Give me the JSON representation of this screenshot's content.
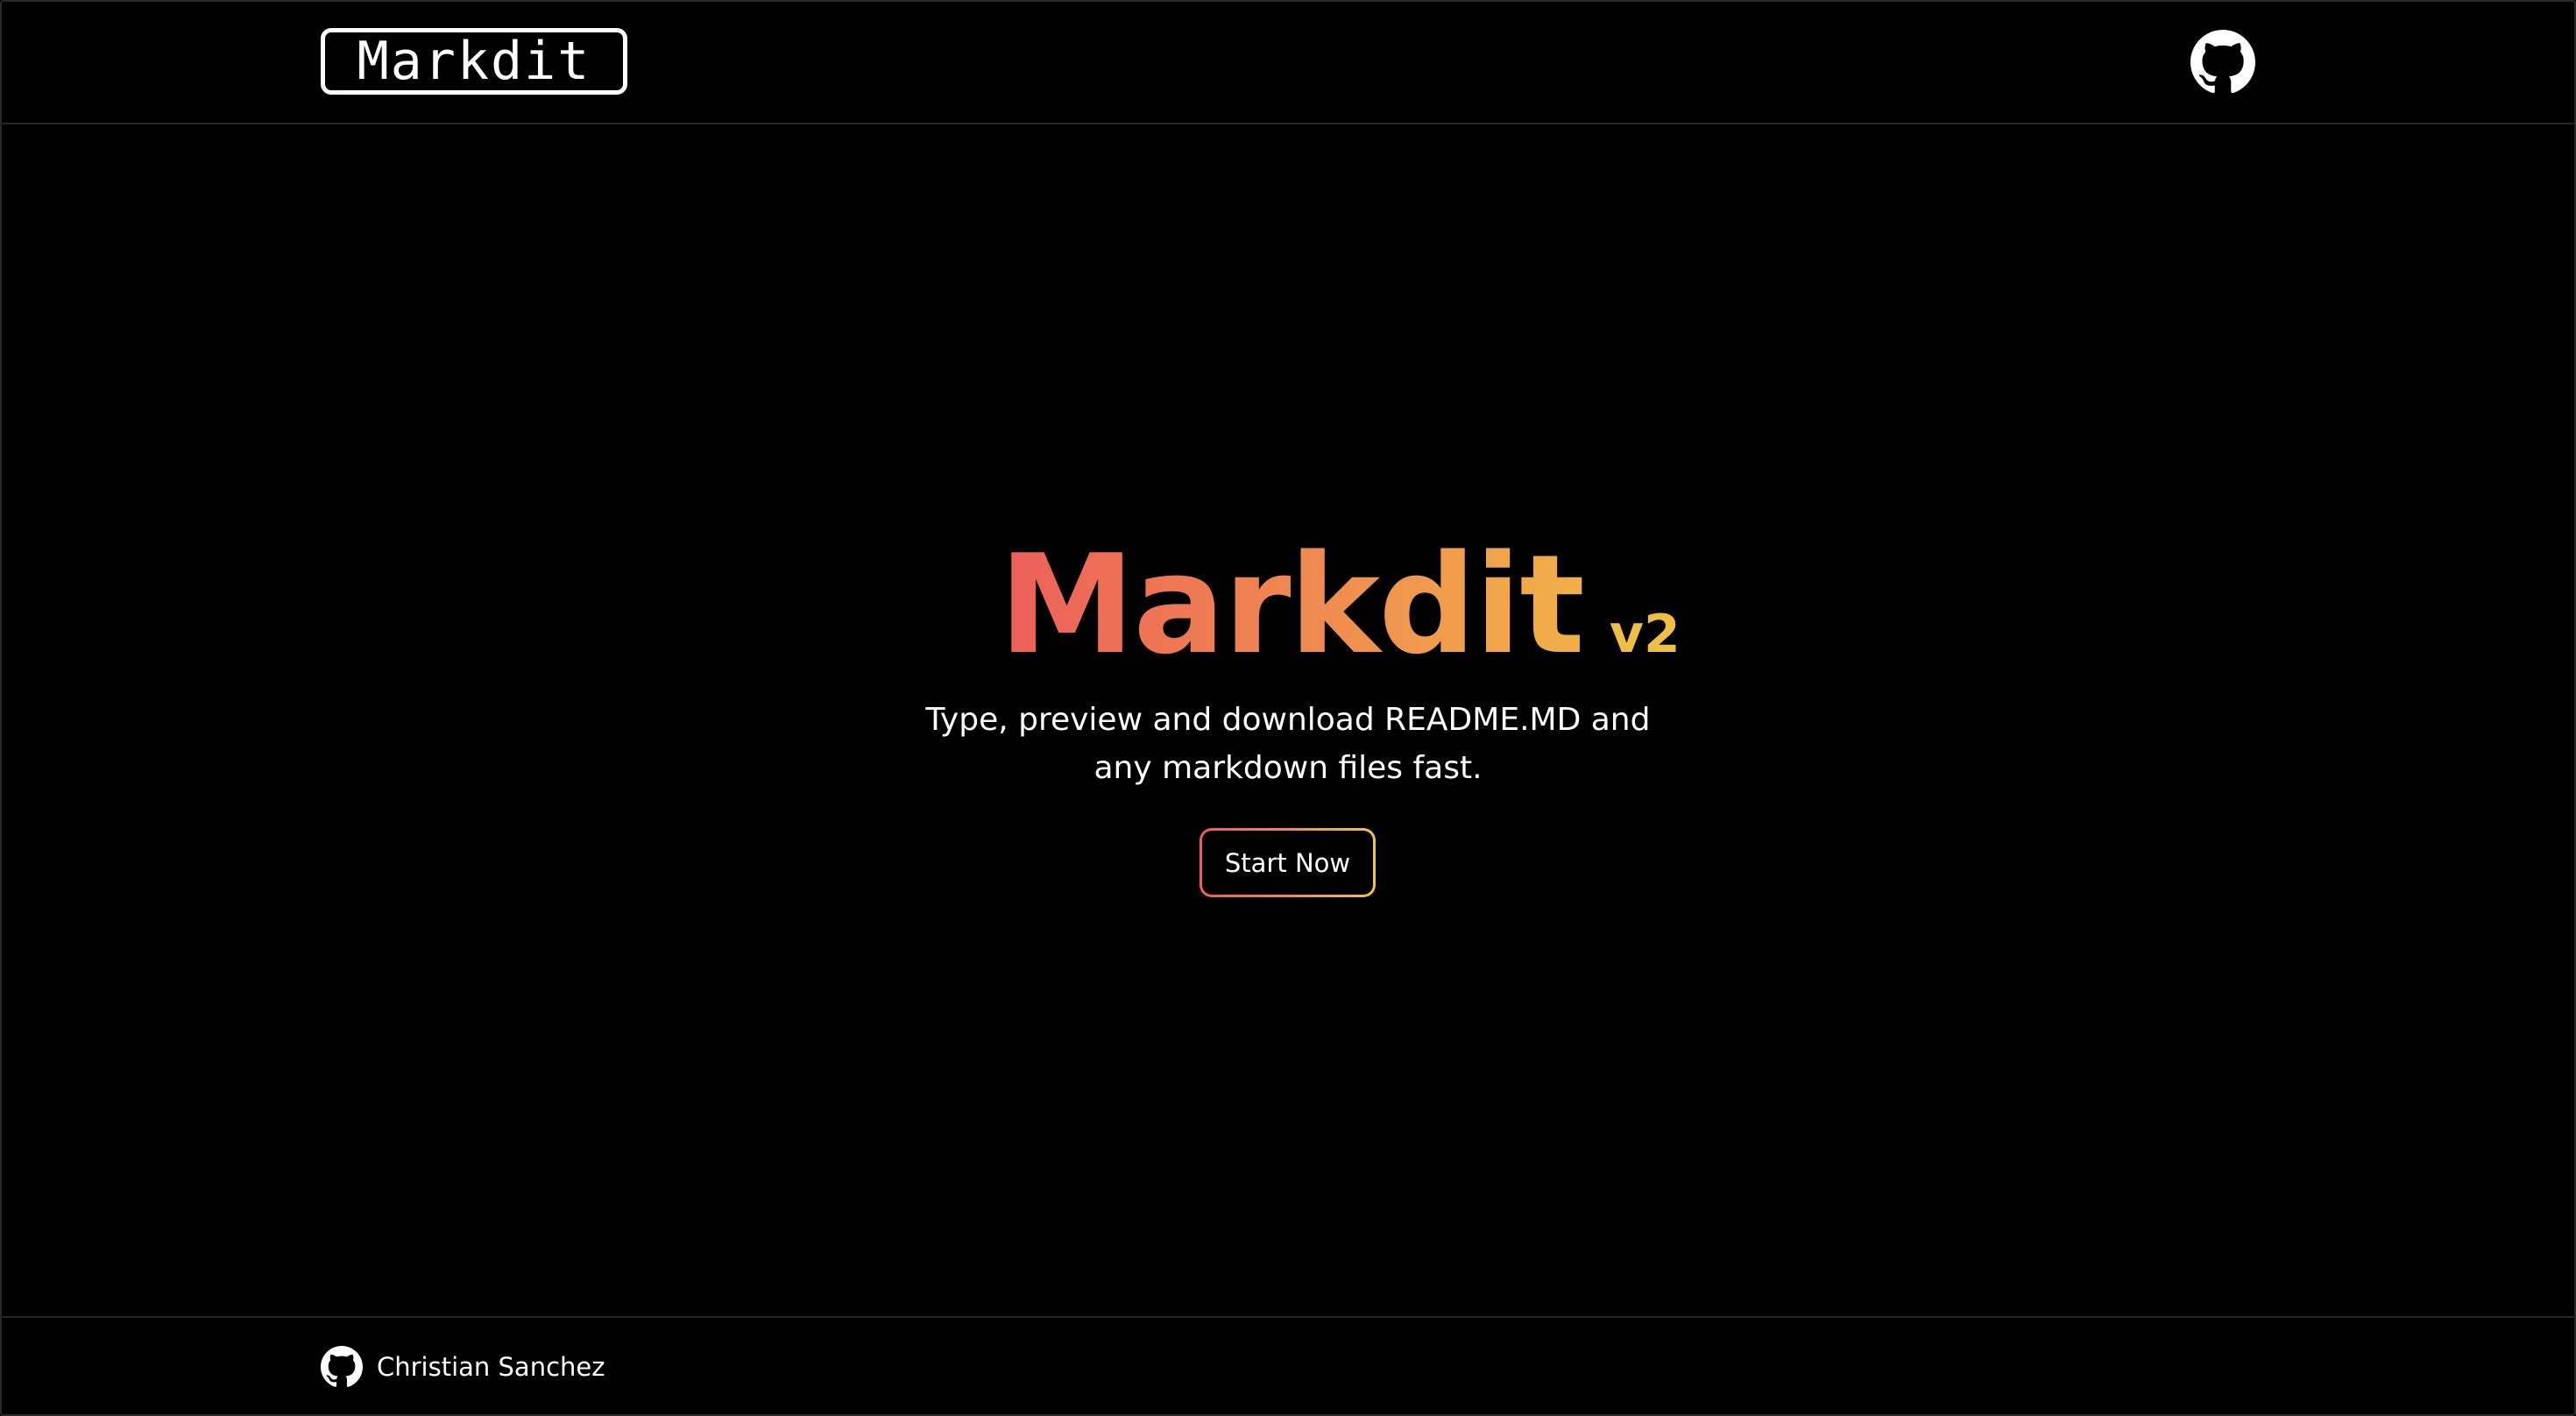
{
  "header": {
    "logo_text": "Markdit",
    "github_icon": "github-icon"
  },
  "hero": {
    "title": "Markdit",
    "version": "v2",
    "subtitle": "Type, preview and download README.MD and any markdown files fast.",
    "cta_label": "Start Now"
  },
  "footer": {
    "author_name": "Christian Sanchez",
    "github_icon": "github-icon"
  },
  "colors": {
    "background": "#000000",
    "gradient_start": "#ec5f5a",
    "gradient_end": "#f1c44a",
    "version_color": "#eebe45",
    "text": "#ffffff"
  }
}
